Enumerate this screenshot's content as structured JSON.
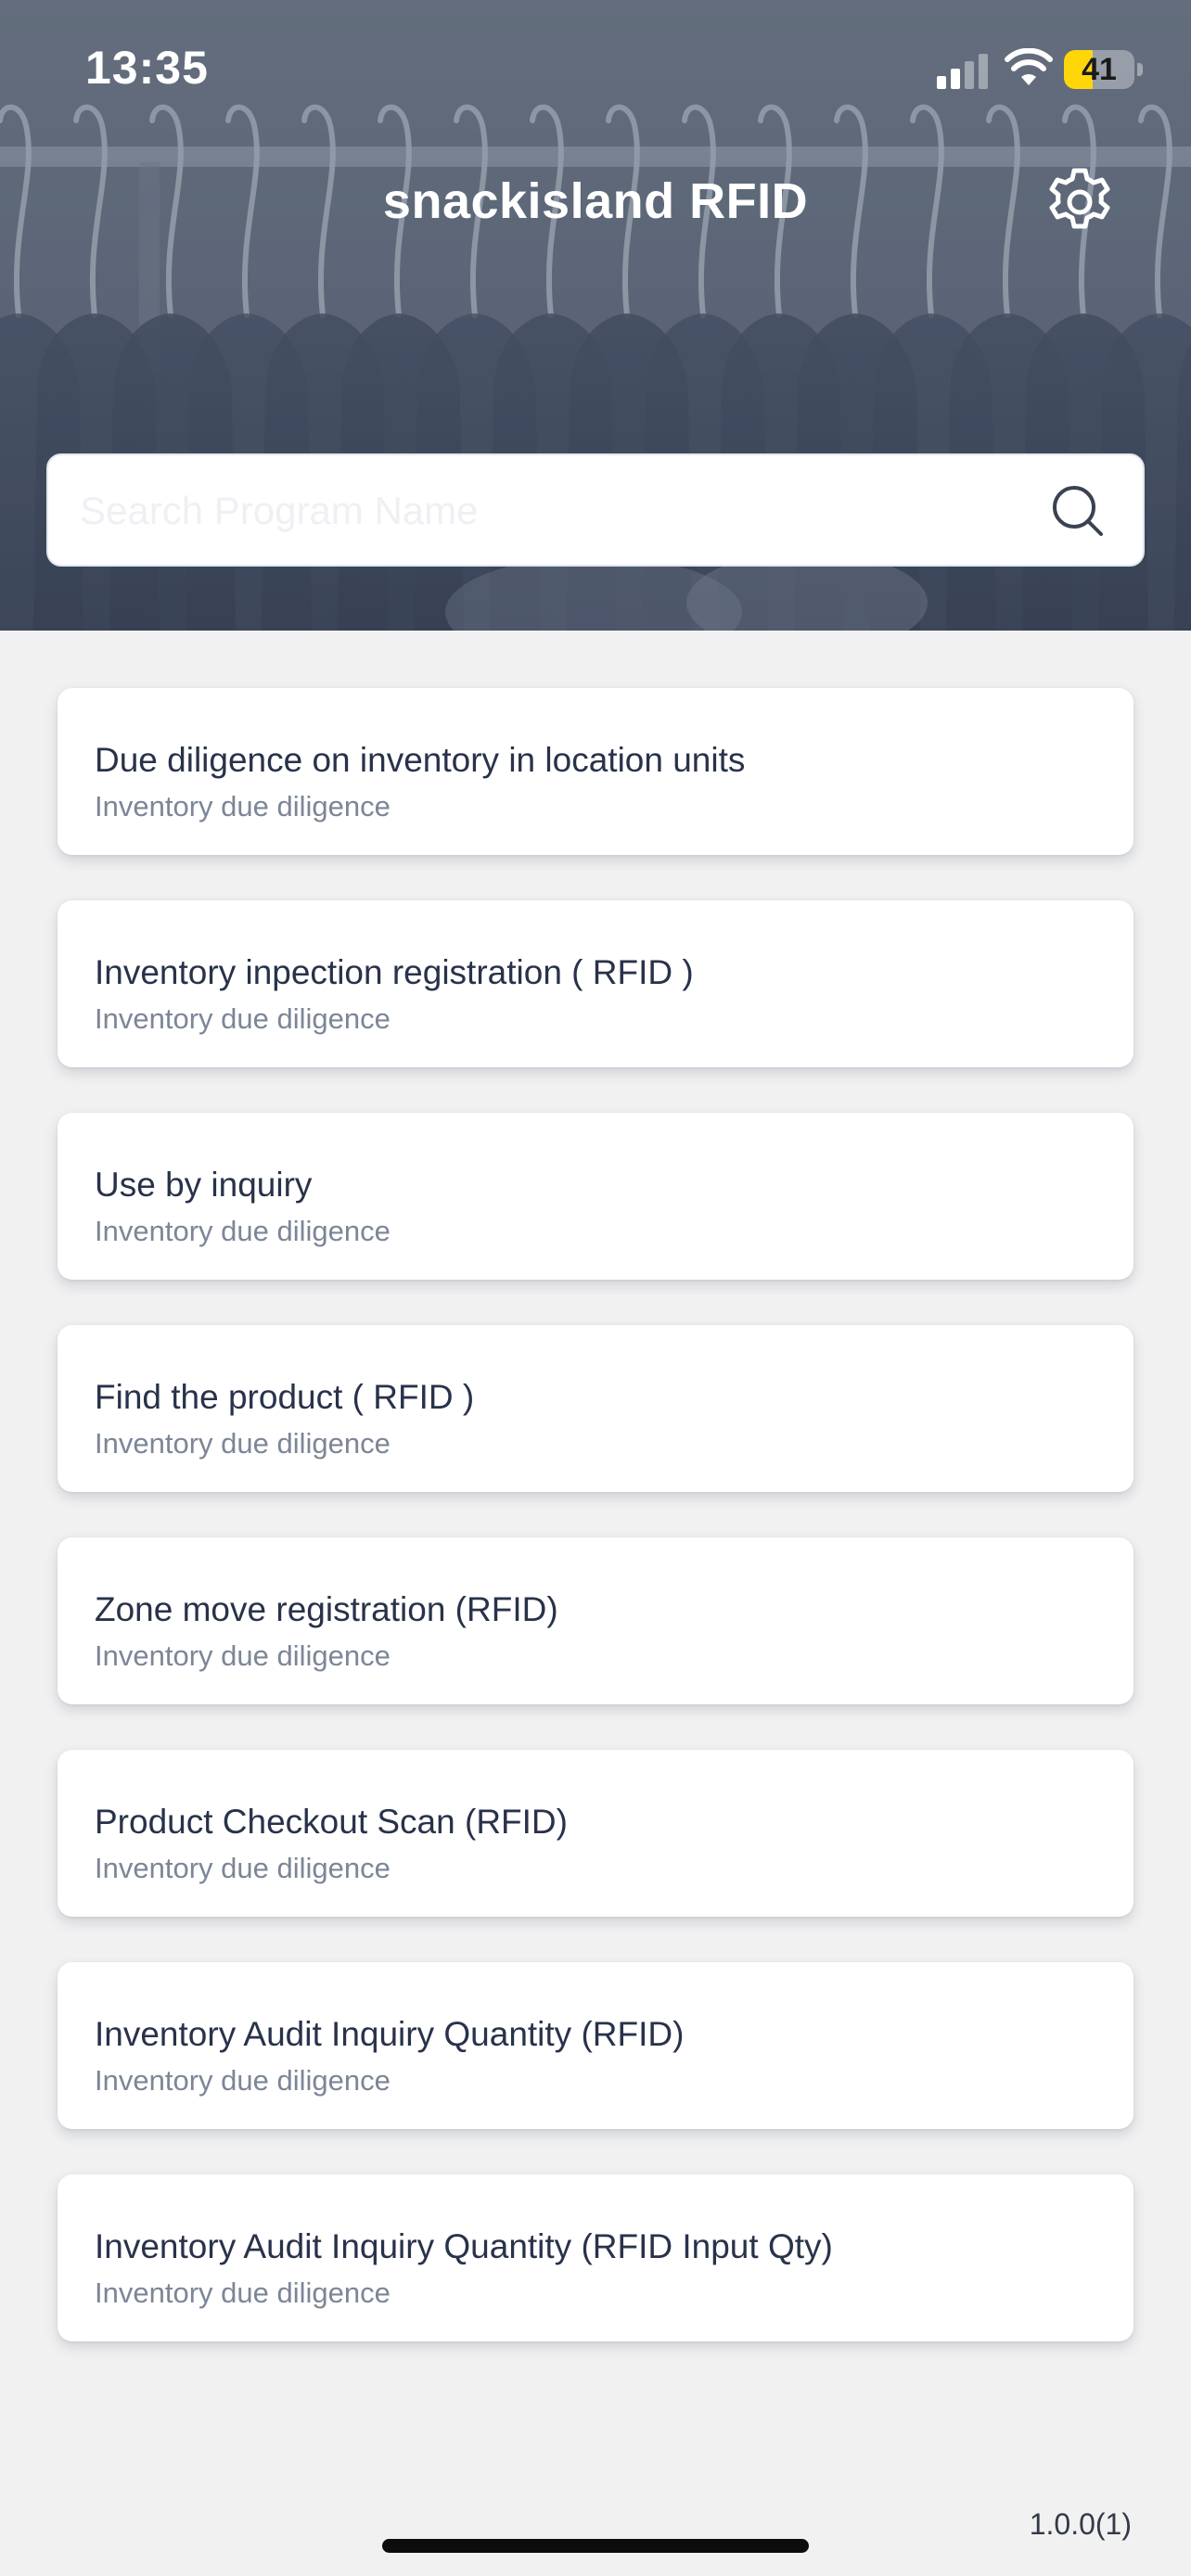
{
  "status_bar": {
    "time": "13:35",
    "battery_level": "41",
    "battery_percent": 41,
    "signal_bars_active": 2,
    "icons": [
      "cellular-signal-icon",
      "wifi-icon",
      "battery-icon"
    ]
  },
  "header": {
    "title": "snackisland RFID",
    "settings_icon": "gear-icon"
  },
  "search": {
    "placeholder": "Search Program Name",
    "value": "",
    "icon": "search-icon"
  },
  "programs": [
    {
      "title": "Due diligence on inventory in location units",
      "subtitle": "Inventory due diligence"
    },
    {
      "title": "Inventory inpection registration ( RFID )",
      "subtitle": "Inventory due diligence"
    },
    {
      "title": "Use by inquiry",
      "subtitle": "Inventory due diligence"
    },
    {
      "title": "Find the product ( RFID )",
      "subtitle": "Inventory due diligence"
    },
    {
      "title": "Zone move registration (RFID)",
      "subtitle": "Inventory due diligence"
    },
    {
      "title": "Product Checkout Scan (RFID)",
      "subtitle": "Inventory due diligence"
    },
    {
      "title": "Inventory Audit Inquiry Quantity (RFID)",
      "subtitle": "Inventory due diligence"
    },
    {
      "title": "Inventory Audit Inquiry Quantity (RFID Input Qty)",
      "subtitle": "Inventory due diligence"
    }
  ],
  "footer": {
    "version": "1.0.0(1)"
  },
  "colors": {
    "header_bg": "#5c6678",
    "page_bg": "#f1f1f2",
    "card_title": "#28324a",
    "card_subtitle": "#7c8697",
    "battery_fill": "#ffd60a"
  }
}
